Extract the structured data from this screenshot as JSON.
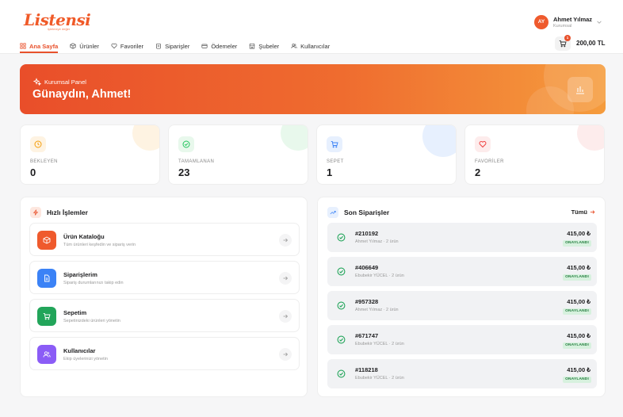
{
  "header": {
    "logo": "Listensi",
    "logo_tagline": "işletmeye değer",
    "user": {
      "initials": "AY",
      "name": "Ahmet Yılmaz",
      "role": "Kurumsal"
    },
    "cart": {
      "count": "1",
      "total": "200,00 TL"
    }
  },
  "nav": [
    {
      "label": "Ana Sayfa",
      "icon": "grid-icon",
      "active": true
    },
    {
      "label": "Ürünler",
      "icon": "box-icon"
    },
    {
      "label": "Favoriler",
      "icon": "heart-icon"
    },
    {
      "label": "Siparişler",
      "icon": "clipboard-icon"
    },
    {
      "label": "Ödemeler",
      "icon": "credit-card-icon"
    },
    {
      "label": "Şubeler",
      "icon": "store-icon"
    },
    {
      "label": "Kullanıcılar",
      "icon": "users-icon"
    }
  ],
  "banner": {
    "tag": "Kurumsal Panel",
    "greeting": "Günaydın, Ahmet!"
  },
  "stats": [
    {
      "label": "BEKLEYEN",
      "value": "0",
      "color": "#f59e0b",
      "icon": "clock-icon"
    },
    {
      "label": "TAMAMLANAN",
      "value": "23",
      "color": "#22c55e",
      "icon": "check-circle-icon"
    },
    {
      "label": "SEPET",
      "value": "1",
      "color": "#3b82f6",
      "icon": "cart-icon"
    },
    {
      "label": "FAVORİLER",
      "value": "2",
      "color": "#ef4444",
      "icon": "heart-icon"
    }
  ],
  "quick_actions": {
    "title": "Hızlı İşlemler",
    "items": [
      {
        "title": "Ürün Kataloğu",
        "desc": "Tüm ürünleri keşfedin ve sipariş verin",
        "color": "#ef5a2d"
      },
      {
        "title": "Siparişlerim",
        "desc": "Sipariş durumlarınızı takip edin",
        "color": "#3b82f6"
      },
      {
        "title": "Sepetim",
        "desc": "Sepetinizdeki ürünleri yönetin",
        "color": "#22a55a"
      },
      {
        "title": "Kullanıcılar",
        "desc": "Ekip üyelerinizi yönetin",
        "color": "#8b5cf6"
      }
    ]
  },
  "recent_orders": {
    "title": "Son Siparişler",
    "all_label": "Tümü",
    "items": [
      {
        "number": "#210192",
        "sub": "Ahmet Yılmaz · 2 ürün",
        "amount": "415,00 ₺",
        "status": "ONAYLANDI"
      },
      {
        "number": "#406649",
        "sub": "Ebubekir YÜCEL · 2 ürün",
        "amount": "415,00 ₺",
        "status": "ONAYLANDI"
      },
      {
        "number": "#957328",
        "sub": "Ahmet Yılmaz · 2 ürün",
        "amount": "415,00 ₺",
        "status": "ONAYLANDI"
      },
      {
        "number": "#671747",
        "sub": "Ebubekir YÜCEL · 2 ürün",
        "amount": "415,00 ₺",
        "status": "ONAYLANDI"
      },
      {
        "number": "#118218",
        "sub": "Ebubekir YÜCEL · 2 ürün",
        "amount": "415,00 ₺",
        "status": "ONAYLANDI"
      }
    ]
  }
}
